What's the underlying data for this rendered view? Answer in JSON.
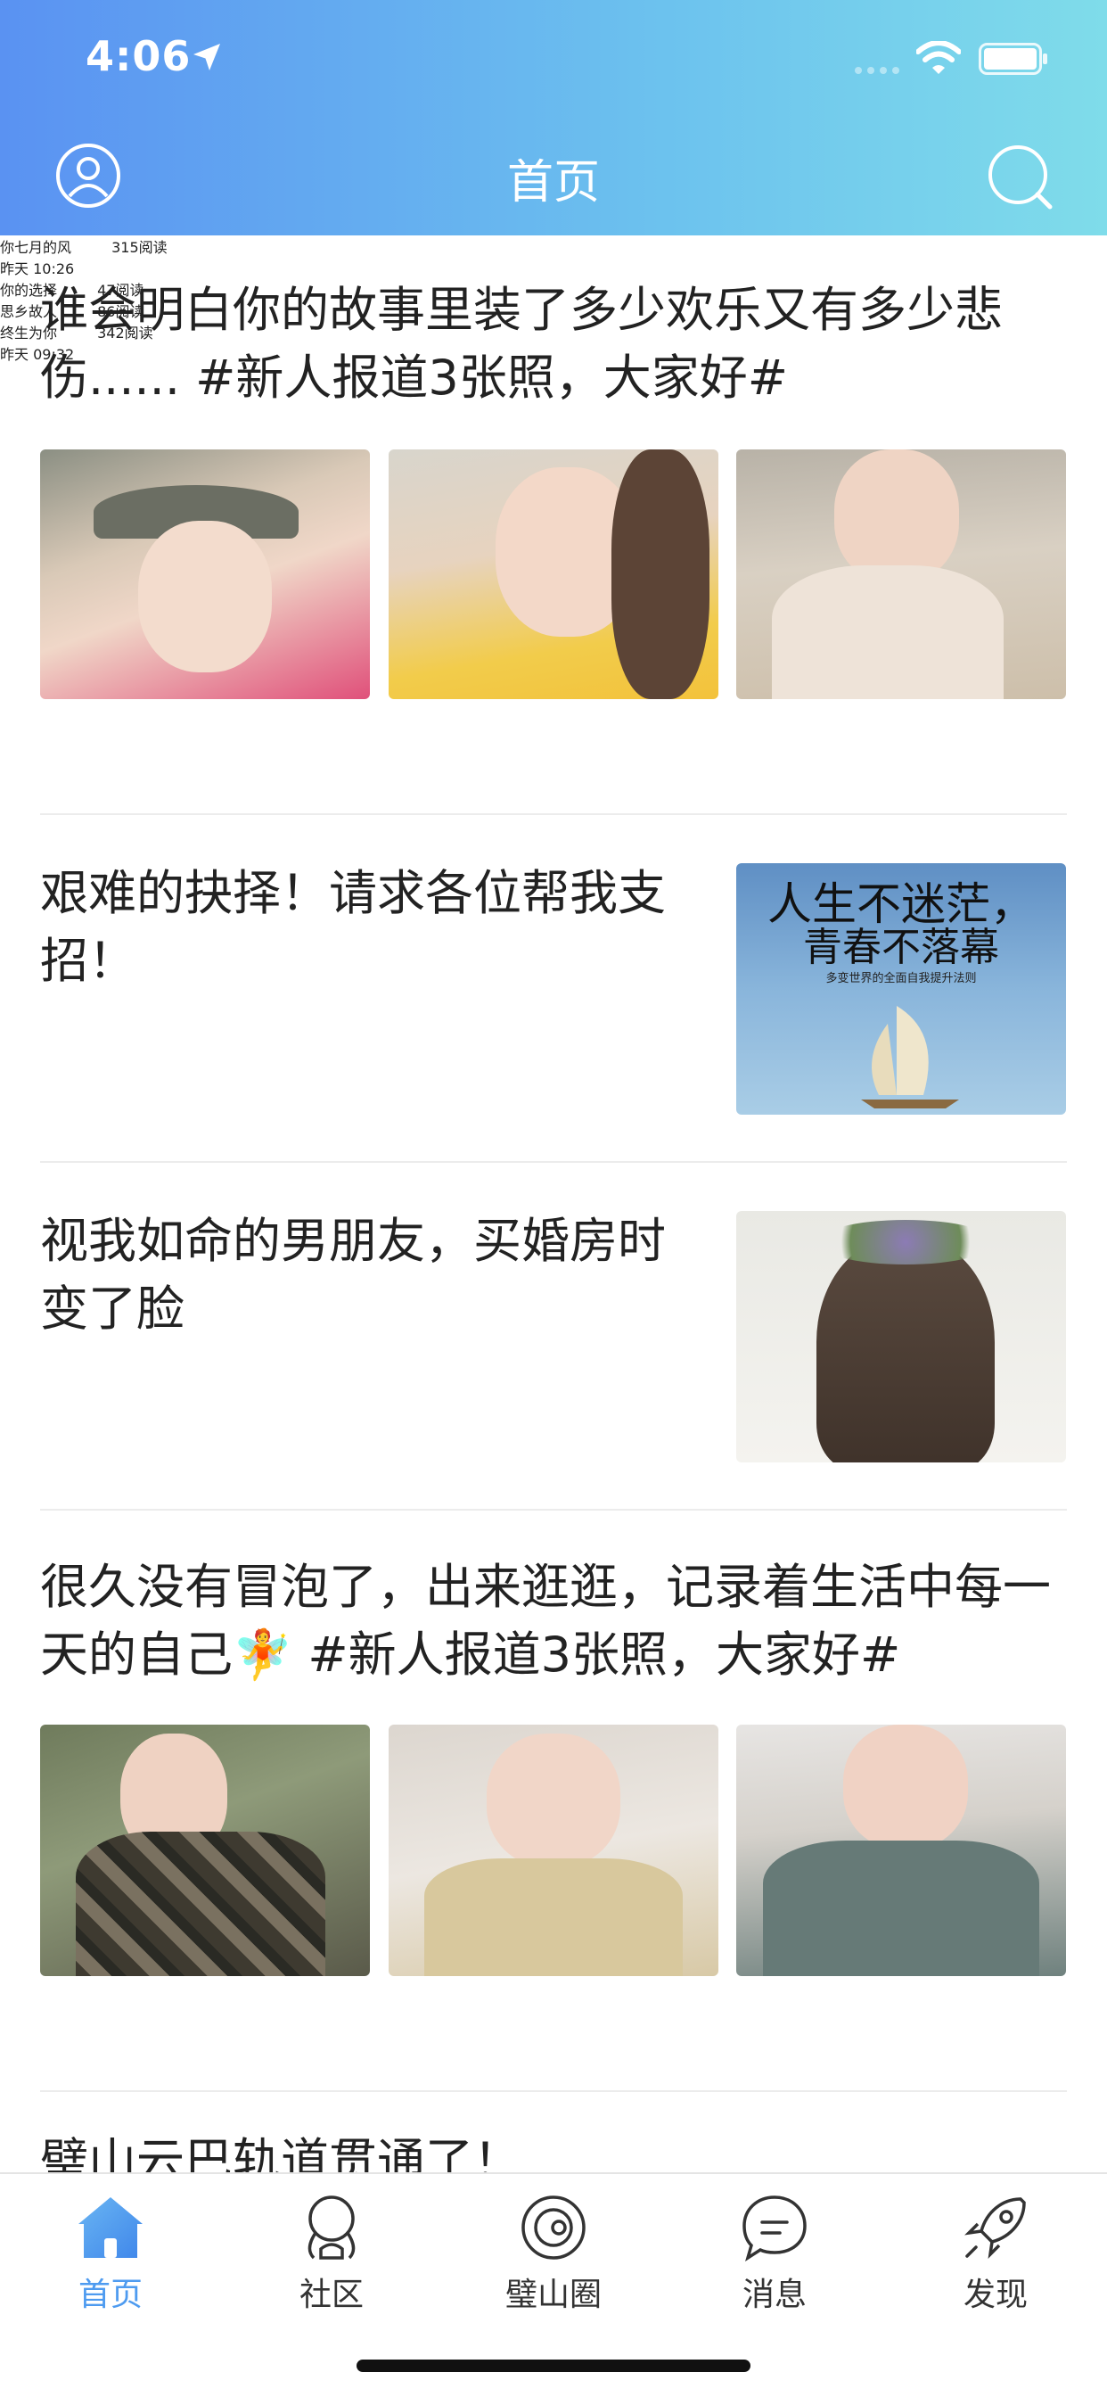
{
  "status_bar": {
    "time": "4:06"
  },
  "nav": {
    "title": "首页"
  },
  "posts": [
    {
      "title": "谁会明白你的故事里装了多少欢乐又有多少悲伤...... #新人报道3张照，大家好#",
      "author": "你七月的风",
      "reads": "315阅读",
      "time": "昨天 10:26"
    },
    {
      "title": "艰难的抉择！请求各位帮我支招！",
      "author": "你的选择",
      "reads": "47阅读",
      "cover_text_1": "人生不迷茫，",
      "cover_text_2": "青春不落幕",
      "cover_text_3": "多变世界的全面自我提升法则"
    },
    {
      "title": "视我如命的男朋友，买婚房时变了脸",
      "author": "思乡故人",
      "reads": "86阅读"
    },
    {
      "title": "很久没有冒泡了，出来逛逛，记录着生活中每一天的自己🧚 #新人报道3张照，大家好#",
      "author": "终生为你",
      "reads": "342阅读",
      "time": "昨天 09:32"
    },
    {
      "title": "璧山云巴轨道贯通了！"
    }
  ],
  "tabs": [
    {
      "label": "首页",
      "icon": "home-icon",
      "active": true
    },
    {
      "label": "社区",
      "icon": "community-icon"
    },
    {
      "label": "璧山圈",
      "icon": "circle-icon"
    },
    {
      "label": "消息",
      "icon": "message-icon"
    },
    {
      "label": "发现",
      "icon": "rocket-icon"
    }
  ],
  "colors": {
    "accent": "#4e9bf0",
    "header_start": "#5a92f2",
    "header_end": "#7fdcea",
    "meta": "#8e8e8e"
  }
}
